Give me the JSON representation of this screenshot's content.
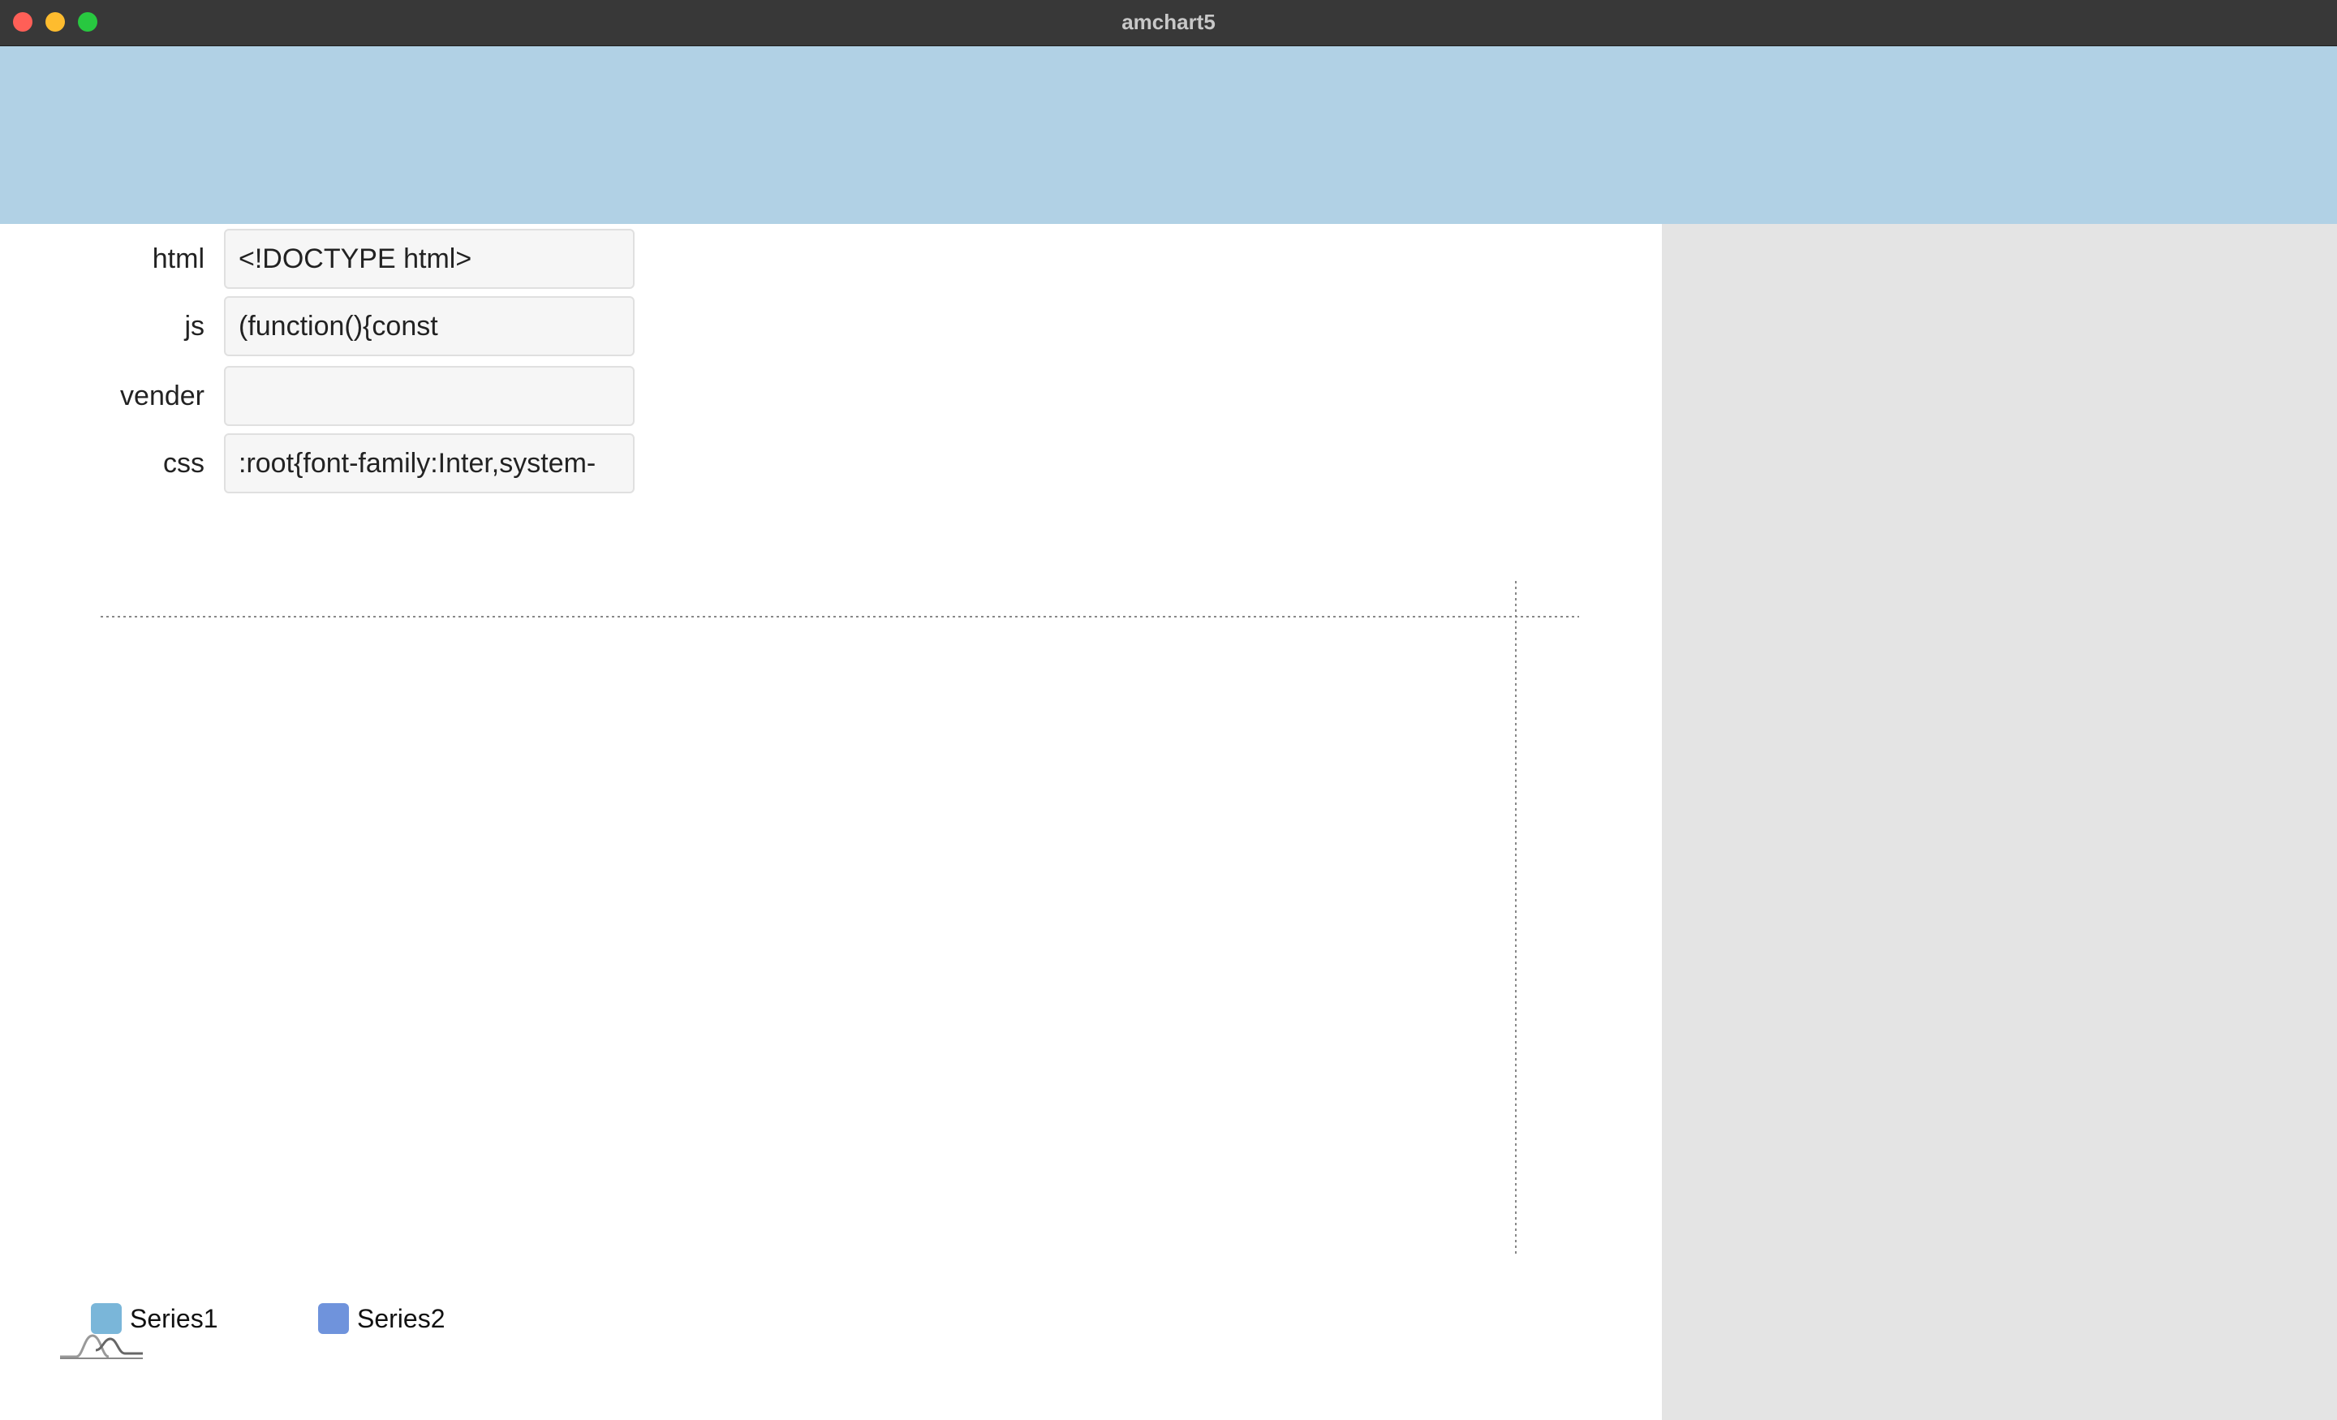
{
  "window": {
    "title": "amchart5"
  },
  "form": {
    "rows": [
      {
        "label": "html",
        "value": "<!DOCTYPE html>"
      },
      {
        "label": "js",
        "value": "(function(){const"
      },
      {
        "label": "vender",
        "value": ""
      },
      {
        "label": "css",
        "value": ":root{font-family:Inter,system-"
      }
    ]
  },
  "legend": {
    "items": [
      {
        "label": "Series1",
        "color": "#7ab6d9"
      },
      {
        "label": "Series2",
        "color": "#6f93dc"
      }
    ]
  },
  "colors": {
    "header_band": "#b1d1e5",
    "side_panel": "#e4e4e4",
    "titlebar": "#383838"
  },
  "icons": [
    "amcharts-logo-icon"
  ]
}
